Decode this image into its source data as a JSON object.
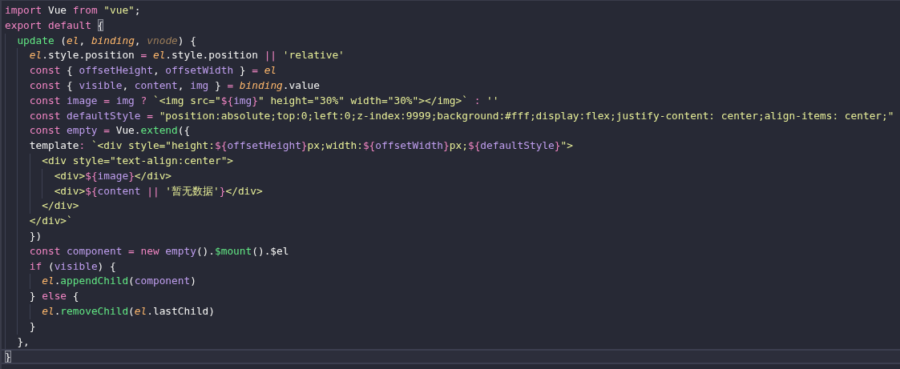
{
  "editor": {
    "lines": [
      {
        "current": false,
        "tokens": [
          {
            "text": "import ",
            "kind": "keyword"
          },
          {
            "text": "Vue ",
            "kind": "plain"
          },
          {
            "text": "from ",
            "kind": "keyword"
          },
          {
            "text": "\"vue\"",
            "kind": "string"
          },
          {
            "text": ";",
            "kind": "plain"
          }
        ]
      },
      {
        "current": false,
        "tokens": [
          {
            "text": "export default ",
            "kind": "keyword"
          },
          {
            "text": "{",
            "kind": "bracket-match"
          }
        ]
      },
      {
        "current": false,
        "tokens": [
          {
            "text": "  update ",
            "kind": "function"
          },
          {
            "text": "(",
            "kind": "plain"
          },
          {
            "text": "el",
            "kind": "param"
          },
          {
            "text": ", ",
            "kind": "plain"
          },
          {
            "text": "binding",
            "kind": "param"
          },
          {
            "text": ", ",
            "kind": "plain"
          },
          {
            "text": "vnode",
            "kind": "unused"
          },
          {
            "text": ") {",
            "kind": "plain"
          }
        ]
      },
      {
        "current": false,
        "tokens": [
          {
            "text": "    el",
            "kind": "param"
          },
          {
            "text": ".style.position ",
            "kind": "plain"
          },
          {
            "text": "= ",
            "kind": "keyword"
          },
          {
            "text": "el",
            "kind": "param"
          },
          {
            "text": ".style.position ",
            "kind": "plain"
          },
          {
            "text": "|| ",
            "kind": "keyword"
          },
          {
            "text": "'relative'",
            "kind": "string"
          }
        ]
      },
      {
        "current": false,
        "tokens": [
          {
            "text": "    const",
            "kind": "keyword"
          },
          {
            "text": " { ",
            "kind": "plain"
          },
          {
            "text": "offsetHeight",
            "kind": "variable"
          },
          {
            "text": ", ",
            "kind": "plain"
          },
          {
            "text": "offsetWidth",
            "kind": "variable"
          },
          {
            "text": " } ",
            "kind": "plain"
          },
          {
            "text": "= ",
            "kind": "keyword"
          },
          {
            "text": "el",
            "kind": "param"
          }
        ]
      },
      {
        "current": false,
        "tokens": [
          {
            "text": "    const",
            "kind": "keyword"
          },
          {
            "text": " { ",
            "kind": "plain"
          },
          {
            "text": "visible",
            "kind": "variable"
          },
          {
            "text": ", ",
            "kind": "plain"
          },
          {
            "text": "content",
            "kind": "variable"
          },
          {
            "text": ", ",
            "kind": "plain"
          },
          {
            "text": "img",
            "kind": "variable"
          },
          {
            "text": " } ",
            "kind": "plain"
          },
          {
            "text": "= ",
            "kind": "keyword"
          },
          {
            "text": "binding",
            "kind": "param"
          },
          {
            "text": ".value",
            "kind": "plain"
          }
        ]
      },
      {
        "current": false,
        "tokens": [
          {
            "text": "    const ",
            "kind": "keyword"
          },
          {
            "text": "image ",
            "kind": "variable"
          },
          {
            "text": "= ",
            "kind": "keyword"
          },
          {
            "text": "img ",
            "kind": "variable"
          },
          {
            "text": "? ",
            "kind": "keyword"
          },
          {
            "text": "`<img src=\"",
            "kind": "string"
          },
          {
            "text": "${",
            "kind": "keyword"
          },
          {
            "text": "img",
            "kind": "variable"
          },
          {
            "text": "}",
            "kind": "keyword"
          },
          {
            "text": "\" height=\"30%\" width=\"30%\"></img>` ",
            "kind": "string"
          },
          {
            "text": ": ",
            "kind": "keyword"
          },
          {
            "text": "''",
            "kind": "string"
          }
        ]
      },
      {
        "current": false,
        "tokens": [
          {
            "text": "    const ",
            "kind": "keyword"
          },
          {
            "text": "defaultStyle ",
            "kind": "variable"
          },
          {
            "text": "= ",
            "kind": "keyword"
          },
          {
            "text": "\"position:absolute;top:0;left:0;z-index:9999;background:#fff;display:flex;justify-content: center;align-items: center;\"",
            "kind": "string"
          }
        ]
      },
      {
        "current": false,
        "tokens": [
          {
            "text": "    const ",
            "kind": "keyword"
          },
          {
            "text": "empty ",
            "kind": "variable"
          },
          {
            "text": "=",
            "kind": "keyword"
          },
          {
            "text": " Vue.",
            "kind": "plain"
          },
          {
            "text": "extend",
            "kind": "function"
          },
          {
            "text": "({",
            "kind": "plain"
          }
        ]
      },
      {
        "current": false,
        "tokens": [
          {
            "text": "    template",
            "kind": "plain"
          },
          {
            "text": ": ",
            "kind": "keyword"
          },
          {
            "text": "`<div style=\"height:",
            "kind": "string"
          },
          {
            "text": "${",
            "kind": "keyword"
          },
          {
            "text": "offsetHeight",
            "kind": "variable"
          },
          {
            "text": "}",
            "kind": "keyword"
          },
          {
            "text": "px;width:",
            "kind": "string"
          },
          {
            "text": "${",
            "kind": "keyword"
          },
          {
            "text": "offsetWidth",
            "kind": "variable"
          },
          {
            "text": "}",
            "kind": "keyword"
          },
          {
            "text": "px;",
            "kind": "string"
          },
          {
            "text": "${",
            "kind": "keyword"
          },
          {
            "text": "defaultStyle",
            "kind": "variable"
          },
          {
            "text": "}",
            "kind": "keyword"
          },
          {
            "text": "\">",
            "kind": "string"
          }
        ]
      },
      {
        "current": false,
        "tokens": [
          {
            "text": "      <div style=\"text-align:center\">",
            "kind": "string"
          }
        ]
      },
      {
        "current": false,
        "tokens": [
          {
            "text": "        <div>",
            "kind": "string"
          },
          {
            "text": "${",
            "kind": "keyword"
          },
          {
            "text": "image",
            "kind": "variable"
          },
          {
            "text": "}",
            "kind": "keyword"
          },
          {
            "text": "</div>",
            "kind": "string"
          }
        ]
      },
      {
        "current": false,
        "tokens": [
          {
            "text": "        <div>",
            "kind": "string"
          },
          {
            "text": "${",
            "kind": "keyword"
          },
          {
            "text": "content ",
            "kind": "variable"
          },
          {
            "text": "|| ",
            "kind": "keyword"
          },
          {
            "text": "'暂无数据'",
            "kind": "string"
          },
          {
            "text": "}",
            "kind": "keyword"
          },
          {
            "text": "</div>",
            "kind": "string"
          }
        ]
      },
      {
        "current": false,
        "tokens": [
          {
            "text": "      </div>",
            "kind": "string"
          }
        ]
      },
      {
        "current": false,
        "tokens": [
          {
            "text": "    </div>`",
            "kind": "string"
          }
        ]
      },
      {
        "current": false,
        "tokens": [
          {
            "text": "    })",
            "kind": "plain"
          }
        ]
      },
      {
        "current": false,
        "tokens": [
          {
            "text": "    const ",
            "kind": "keyword"
          },
          {
            "text": "component ",
            "kind": "variable"
          },
          {
            "text": "= ",
            "kind": "keyword"
          },
          {
            "text": "new ",
            "kind": "keyword"
          },
          {
            "text": "empty",
            "kind": "variable"
          },
          {
            "text": "().",
            "kind": "plain"
          },
          {
            "text": "$mount",
            "kind": "function"
          },
          {
            "text": "().$el",
            "kind": "plain"
          }
        ]
      },
      {
        "current": false,
        "tokens": [
          {
            "text": "    if",
            "kind": "keyword"
          },
          {
            "text": " (",
            "kind": "plain"
          },
          {
            "text": "visible",
            "kind": "variable"
          },
          {
            "text": ") {",
            "kind": "plain"
          }
        ]
      },
      {
        "current": false,
        "tokens": [
          {
            "text": "      el",
            "kind": "param"
          },
          {
            "text": ".",
            "kind": "plain"
          },
          {
            "text": "appendChild",
            "kind": "function"
          },
          {
            "text": "(",
            "kind": "plain"
          },
          {
            "text": "component",
            "kind": "variable"
          },
          {
            "text": ")",
            "kind": "plain"
          }
        ]
      },
      {
        "current": false,
        "tokens": [
          {
            "text": "    } ",
            "kind": "plain"
          },
          {
            "text": "else",
            "kind": "keyword"
          },
          {
            "text": " {",
            "kind": "plain"
          }
        ]
      },
      {
        "current": false,
        "tokens": [
          {
            "text": "      el",
            "kind": "param"
          },
          {
            "text": ".",
            "kind": "plain"
          },
          {
            "text": "removeChild",
            "kind": "function"
          },
          {
            "text": "(",
            "kind": "plain"
          },
          {
            "text": "el",
            "kind": "param"
          },
          {
            "text": ".lastChild)",
            "kind": "plain"
          }
        ]
      },
      {
        "current": false,
        "tokens": [
          {
            "text": "    }",
            "kind": "plain"
          }
        ]
      },
      {
        "current": false,
        "tokens": [
          {
            "text": "  },",
            "kind": "plain"
          }
        ]
      },
      {
        "current": true,
        "tokens": [
          {
            "text": "}",
            "kind": "bracket-match"
          }
        ]
      }
    ]
  }
}
